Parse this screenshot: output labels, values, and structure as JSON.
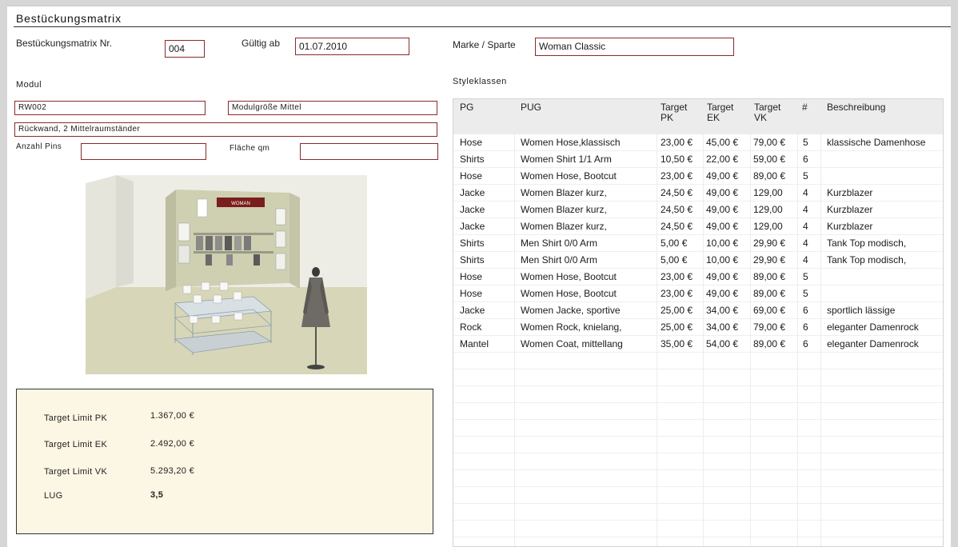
{
  "title": "Bestückungsmatrix",
  "header": {
    "nr_label": "Bestückungsmatrix Nr.",
    "nr_value": "004",
    "gueltig_label": "Gültig ab",
    "gueltig_value": "01.07.2010",
    "marke_label": "Marke / Sparte",
    "marke_value": "Woman Classic"
  },
  "modul": {
    "heading": "Modul",
    "code": "RW002",
    "groesse": "Modulgröße Mittel",
    "beschreibung": "Rückwand, 2 Mittelraumständer",
    "pins_label": "Anzahl Pins",
    "pins_value": "",
    "flaeche_label": "Fläche qm",
    "flaeche_value": ""
  },
  "scene": {
    "banner_text": "WOMAN",
    "icon": "store-display-rendering"
  },
  "limits": {
    "pk_label": "Target Limit PK",
    "pk_value": "1.367,00 €",
    "ek_label": "Target Limit EK",
    "ek_value": "2.492,00 €",
    "vk_label": "Target Limit VK",
    "vk_value": "5.293,20 €",
    "lug_label": "LUG",
    "lug_value": "3,5"
  },
  "styleklassen": {
    "heading": "Styleklassen",
    "columns": {
      "pg": "PG",
      "pug": "PUG",
      "pk1": "Target",
      "pk2": "PK",
      "ek1": "Target",
      "ek2": "EK",
      "vk1": "Target",
      "vk2": "VK",
      "num": "#",
      "desc": "Beschreibung"
    },
    "rows": [
      {
        "pg": "Hose",
        "pug": "Women Hose,klassisch",
        "pk": "23,00 €",
        "ek": "45,00 €",
        "vk": "79,00 €",
        "num": "5",
        "desc": "klassische Damenhose"
      },
      {
        "pg": "Shirts",
        "pug": "Women Shirt 1/1 Arm",
        "pk": "10,50 €",
        "ek": "22,00 €",
        "vk": "59,00 €",
        "num": "6",
        "desc": ""
      },
      {
        "pg": "Hose",
        "pug": "Women Hose, Bootcut",
        "pk": "23,00 €",
        "ek": "49,00 €",
        "vk": "89,00 €",
        "num": "5",
        "desc": ""
      },
      {
        "pg": "Jacke",
        "pug": "Women Blazer kurz,",
        "pk": "24,50 €",
        "ek": "49,00 €",
        "vk": "129,00",
        "num": "4",
        "desc": "Kurzblazer"
      },
      {
        "pg": "Jacke",
        "pug": "Women Blazer kurz,",
        "pk": "24,50 €",
        "ek": "49,00 €",
        "vk": "129,00",
        "num": "4",
        "desc": "Kurzblazer"
      },
      {
        "pg": "Jacke",
        "pug": "Women Blazer kurz,",
        "pk": "24,50 €",
        "ek": "49,00 €",
        "vk": "129,00",
        "num": "4",
        "desc": "Kurzblazer"
      },
      {
        "pg": "Shirts",
        "pug": "Men Shirt 0/0 Arm",
        "pk": "5,00 €",
        "ek": "10,00 €",
        "vk": "29,90 €",
        "num": "4",
        "desc": "Tank Top modisch,"
      },
      {
        "pg": "Shirts",
        "pug": "Men Shirt 0/0 Arm",
        "pk": "5,00 €",
        "ek": "10,00 €",
        "vk": "29,90 €",
        "num": "4",
        "desc": "Tank Top modisch,"
      },
      {
        "pg": "Hose",
        "pug": "Women Hose, Bootcut",
        "pk": "23,00 €",
        "ek": "49,00 €",
        "vk": "89,00 €",
        "num": "5",
        "desc": ""
      },
      {
        "pg": "Hose",
        "pug": "Women Hose, Bootcut",
        "pk": "23,00 €",
        "ek": "49,00 €",
        "vk": "89,00 €",
        "num": "5",
        "desc": ""
      },
      {
        "pg": "Jacke",
        "pug": "Women Jacke, sportive",
        "pk": "25,00 €",
        "ek": "34,00 €",
        "vk": "69,00 €",
        "num": "6",
        "desc": "sportlich lässige"
      },
      {
        "pg": "Rock",
        "pug": "Women Rock, knielang,",
        "pk": "25,00 €",
        "ek": "34,00 €",
        "vk": "79,00 €",
        "num": "6",
        "desc": "eleganter Damenrock"
      },
      {
        "pg": "Mantel",
        "pug": "Women Coat, mittellang",
        "pk": "35,00 €",
        "ek": "54,00 €",
        "vk": "89,00 €",
        "num": "6",
        "desc": "eleganter Damenrock"
      }
    ]
  }
}
